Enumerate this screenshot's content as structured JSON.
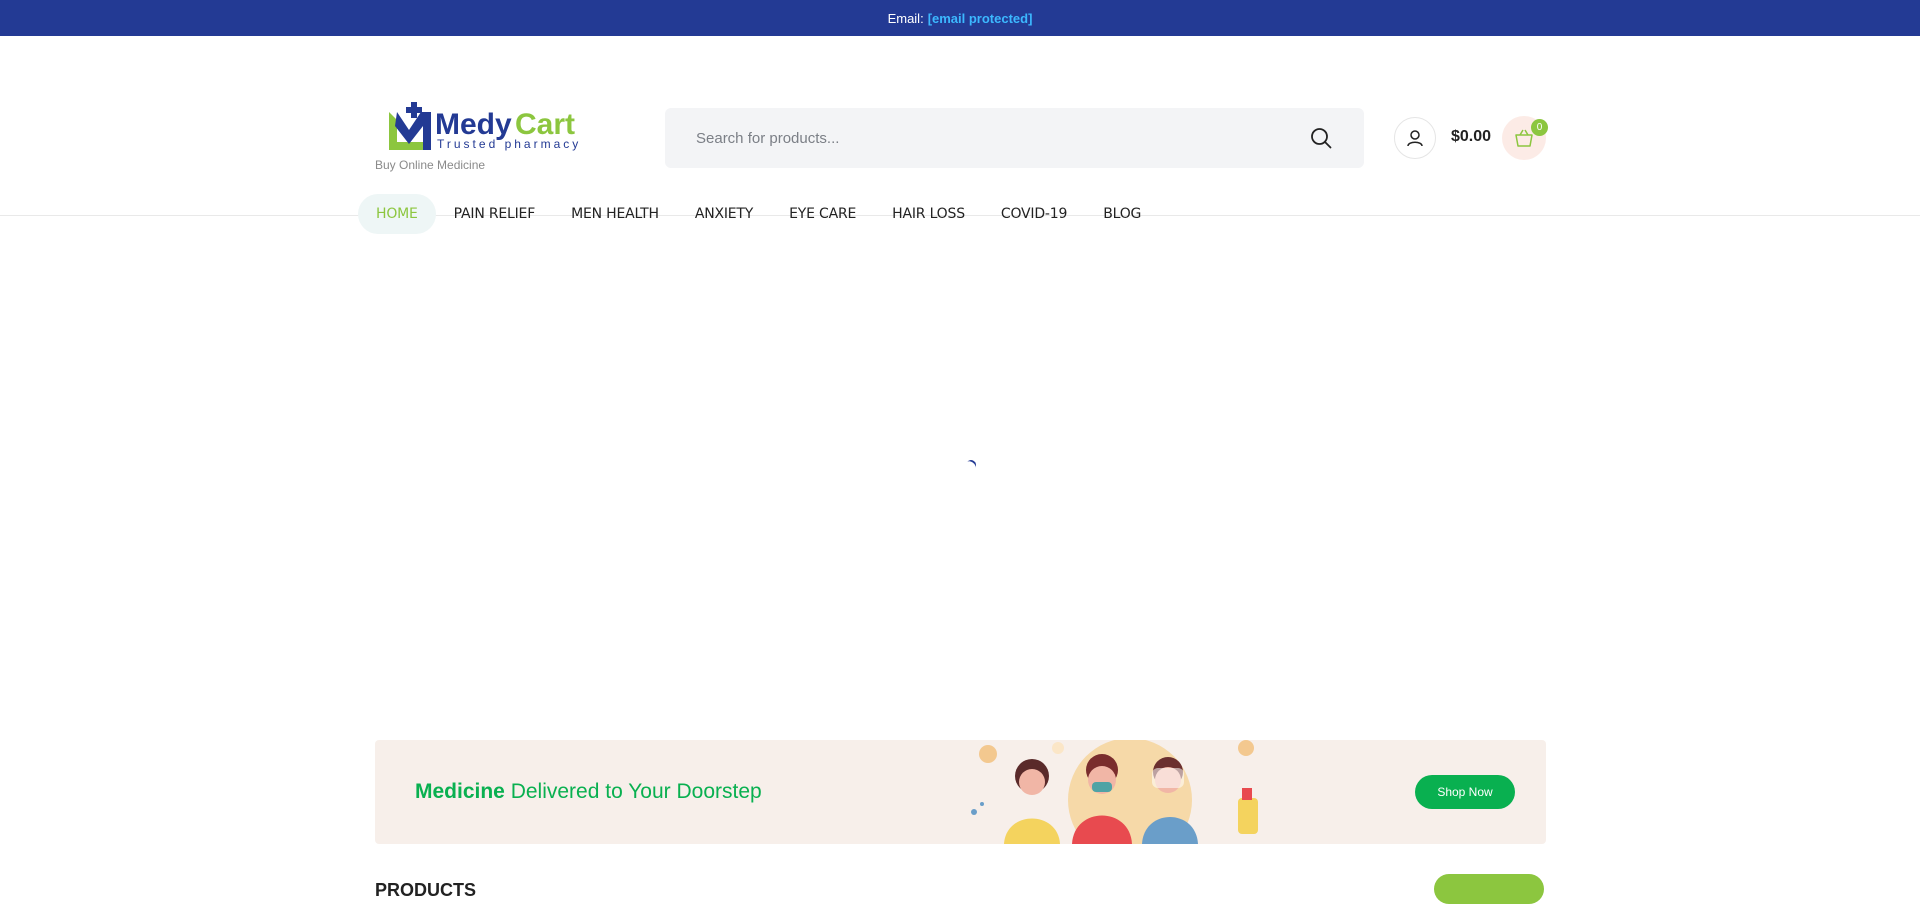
{
  "topbar": {
    "email_label": "Email:",
    "email_value": "[email protected]"
  },
  "logo": {
    "brand_a": "Medy",
    "brand_b": "Cart",
    "tagline": "Trusted pharmacy",
    "subtitle": "Buy Online Medicine"
  },
  "search": {
    "placeholder": "Search for products..."
  },
  "cart": {
    "total": "$0.00",
    "count": "0"
  },
  "nav": {
    "items": [
      "HOME",
      "PAIN RELIEF",
      "MEN HEALTH",
      "ANXIETY",
      "EYE CARE",
      "HAIR LOSS",
      "COVID-19",
      "BLOG"
    ],
    "active": "HOME"
  },
  "banner": {
    "highlight": "Medicine",
    "text": " Delivered to Your Doorstep",
    "button": "Shop Now"
  },
  "products": {
    "title": "PRODUCTS"
  },
  "colors": {
    "topbar": "#233a94",
    "accent_green": "#8cc63f",
    "banner_green": "#09b050",
    "link_blue": "#3cb8ff"
  },
  "icons": {
    "search": "search-icon",
    "account": "user-icon",
    "cart": "basket-icon"
  }
}
